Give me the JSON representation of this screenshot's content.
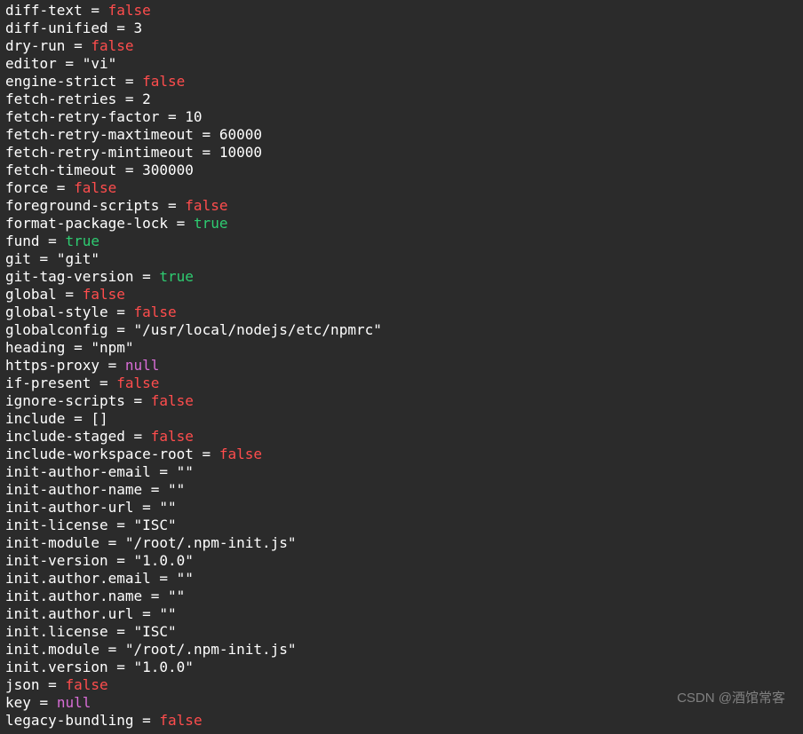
{
  "watermark": "CSDN @酒馆常客",
  "entries": [
    {
      "key": "diff-text",
      "type": "bool",
      "value": "false"
    },
    {
      "key": "diff-unified",
      "type": "num",
      "value": "3"
    },
    {
      "key": "dry-run",
      "type": "bool",
      "value": "false"
    },
    {
      "key": "editor",
      "type": "str",
      "value": "\"vi\""
    },
    {
      "key": "engine-strict",
      "type": "bool",
      "value": "false"
    },
    {
      "key": "fetch-retries",
      "type": "num",
      "value": "2"
    },
    {
      "key": "fetch-retry-factor",
      "type": "num",
      "value": "10"
    },
    {
      "key": "fetch-retry-maxtimeout",
      "type": "num",
      "value": "60000"
    },
    {
      "key": "fetch-retry-mintimeout",
      "type": "num",
      "value": "10000"
    },
    {
      "key": "fetch-timeout",
      "type": "num",
      "value": "300000"
    },
    {
      "key": "force",
      "type": "bool",
      "value": "false"
    },
    {
      "key": "foreground-scripts",
      "type": "bool",
      "value": "false"
    },
    {
      "key": "format-package-lock",
      "type": "bool",
      "value": "true"
    },
    {
      "key": "fund",
      "type": "bool",
      "value": "true"
    },
    {
      "key": "git",
      "type": "str",
      "value": "\"git\""
    },
    {
      "key": "git-tag-version",
      "type": "bool",
      "value": "true"
    },
    {
      "key": "global",
      "type": "bool",
      "value": "false"
    },
    {
      "key": "global-style",
      "type": "bool",
      "value": "false"
    },
    {
      "key": "globalconfig",
      "type": "str",
      "value": "\"/usr/local/nodejs/etc/npmrc\""
    },
    {
      "key": "heading",
      "type": "str",
      "value": "\"npm\""
    },
    {
      "key": "https-proxy",
      "type": "null",
      "value": "null"
    },
    {
      "key": "if-present",
      "type": "bool",
      "value": "false"
    },
    {
      "key": "ignore-scripts",
      "type": "bool",
      "value": "false"
    },
    {
      "key": "include",
      "type": "raw",
      "value": "[]"
    },
    {
      "key": "include-staged",
      "type": "bool",
      "value": "false"
    },
    {
      "key": "include-workspace-root",
      "type": "bool",
      "value": "false"
    },
    {
      "key": "init-author-email",
      "type": "str",
      "value": "\"\""
    },
    {
      "key": "init-author-name",
      "type": "str",
      "value": "\"\""
    },
    {
      "key": "init-author-url",
      "type": "str",
      "value": "\"\""
    },
    {
      "key": "init-license",
      "type": "str",
      "value": "\"ISC\""
    },
    {
      "key": "init-module",
      "type": "str",
      "value": "\"/root/.npm-init.js\""
    },
    {
      "key": "init-version",
      "type": "str",
      "value": "\"1.0.0\""
    },
    {
      "key": "init.author.email",
      "type": "str",
      "value": "\"\""
    },
    {
      "key": "init.author.name",
      "type": "str",
      "value": "\"\""
    },
    {
      "key": "init.author.url",
      "type": "str",
      "value": "\"\""
    },
    {
      "key": "init.license",
      "type": "str",
      "value": "\"ISC\""
    },
    {
      "key": "init.module",
      "type": "str",
      "value": "\"/root/.npm-init.js\""
    },
    {
      "key": "init.version",
      "type": "str",
      "value": "\"1.0.0\""
    },
    {
      "key": "json",
      "type": "bool",
      "value": "false"
    },
    {
      "key": "key",
      "type": "null",
      "value": "null"
    },
    {
      "key": "legacy-bundling",
      "type": "bool",
      "value": "false"
    }
  ]
}
